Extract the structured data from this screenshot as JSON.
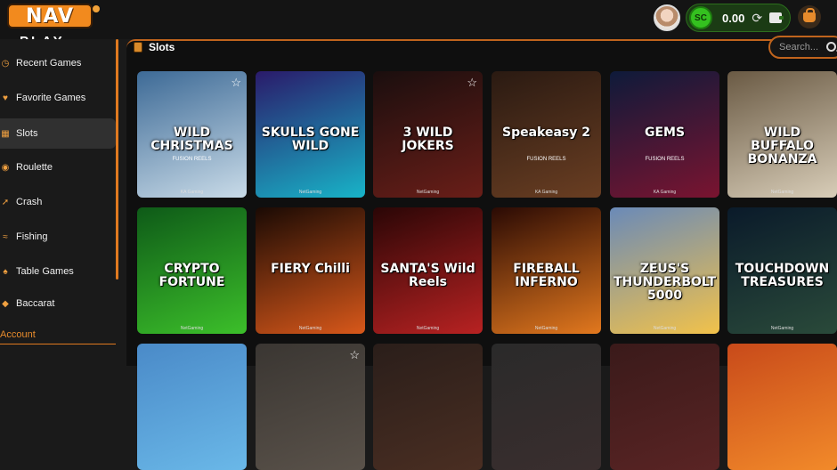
{
  "header": {
    "logo_top": "NAV",
    "logo_bottom": "PLAY",
    "coin_badge": "SC",
    "balance": "0.00",
    "refresh_glyph": "⟳"
  },
  "sidebar": {
    "items": [
      {
        "label": "Recent Games",
        "icon": "clock-icon"
      },
      {
        "label": "Favorite Games",
        "icon": "heart-icon"
      },
      {
        "label": "Slots",
        "icon": "slot-machine-icon",
        "active": true
      },
      {
        "label": "Roulette",
        "icon": "roulette-icon"
      },
      {
        "label": "Crash",
        "icon": "rocket-icon"
      },
      {
        "label": "Fishing",
        "icon": "fish-icon"
      },
      {
        "label": "Table Games",
        "icon": "cards-icon"
      },
      {
        "label": "Baccarat",
        "icon": "chip-icon"
      }
    ],
    "account_label": "Account"
  },
  "main": {
    "section_title": "Slots",
    "search_placeholder": "Search..."
  },
  "games": [
    {
      "title": "WILD CHRISTMAS",
      "sub": "FUSION REELS",
      "provider": "KA Gaming",
      "fav": true,
      "bg1": "#3d6a96",
      "bg2": "#c9dbe8"
    },
    {
      "title": "SKULLS GONE WILD",
      "sub": "",
      "provider": "NetGaming",
      "fav": false,
      "bg1": "#2a1a6a",
      "bg2": "#18b4c8"
    },
    {
      "title": "3 WILD JOKERS",
      "sub": "",
      "provider": "NetGaming",
      "fav": true,
      "bg1": "#1a0e0e",
      "bg2": "#6a1e18"
    },
    {
      "title": "Speakeasy 2",
      "sub": "FUSION REELS",
      "provider": "KA Gaming",
      "fav": false,
      "bg1": "#2a1a12",
      "bg2": "#6a3e22"
    },
    {
      "title": "GEMS",
      "sub": "FUSION REELS",
      "provider": "KA Gaming",
      "fav": false,
      "bg1": "#0e1a3a",
      "bg2": "#7a1430"
    },
    {
      "title": "WILD BUFFALO BONANZA",
      "sub": "",
      "provider": "NetGaming",
      "fav": false,
      "bg1": "#6a5a44",
      "bg2": "#d8cdb8"
    },
    {
      "title": "CRYPTO FORTUNE",
      "sub": "",
      "provider": "NetGaming",
      "fav": false,
      "bg1": "#0e5a18",
      "bg2": "#3cbf2a"
    },
    {
      "title": "FIERY Chilli",
      "sub": "",
      "provider": "NetGaming",
      "fav": false,
      "bg1": "#1a0a04",
      "bg2": "#d8581a"
    },
    {
      "title": "SANTA'S Wild Reels",
      "sub": "",
      "provider": "NetGaming",
      "fav": false,
      "bg1": "#2a0606",
      "bg2": "#b82222"
    },
    {
      "title": "FIREBALL INFERNO",
      "sub": "",
      "provider": "NetGaming",
      "fav": false,
      "bg1": "#2a0a04",
      "bg2": "#e2781e"
    },
    {
      "title": "ZEUS'S THUNDERBOLT 5000",
      "sub": "",
      "provider": "NetGaming",
      "fav": false,
      "bg1": "#6a8ab8",
      "bg2": "#f2c24a"
    },
    {
      "title": "TOUCHDOWN TREASURES",
      "sub": "",
      "provider": "NetGaming",
      "fav": false,
      "bg1": "#0a1a2a",
      "bg2": "#2a4a3a"
    },
    {
      "title": "",
      "sub": "",
      "provider": "",
      "fav": false,
      "bg1": "#4a8ac8",
      "bg2": "#6ab8e8"
    },
    {
      "title": "",
      "sub": "",
      "provider": "",
      "fav": true,
      "bg1": "#3a3632",
      "bg2": "#5a524a"
    },
    {
      "title": "",
      "sub": "",
      "provider": "",
      "fav": false,
      "bg1": "#2a1e1a",
      "bg2": "#4a2e22"
    },
    {
      "title": "",
      "sub": "",
      "provider": "",
      "fav": false,
      "bg1": "#2a2a2a",
      "bg2": "#3a2e2e"
    },
    {
      "title": "",
      "sub": "",
      "provider": "",
      "fav": false,
      "bg1": "#3a1a1a",
      "bg2": "#5a2424"
    },
    {
      "title": "",
      "sub": "",
      "provider": "",
      "fav": false,
      "bg1": "#c84a1a",
      "bg2": "#f28a2a"
    }
  ]
}
